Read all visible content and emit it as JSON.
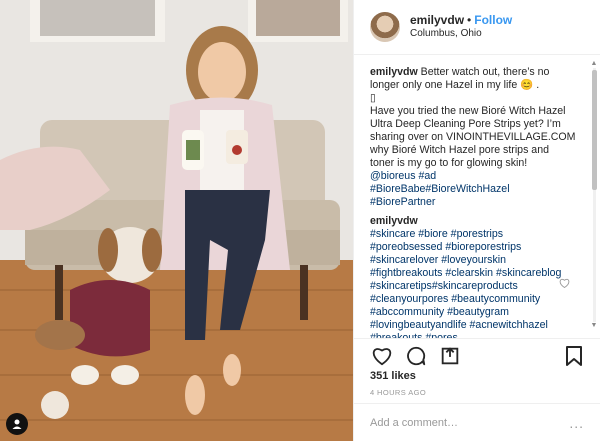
{
  "header": {
    "username": "emilyvdw",
    "separator": "•",
    "follow_label": "Follow",
    "location": "Columbus, Ohio"
  },
  "caption": {
    "username": "emilyvdw",
    "text1": "Better watch out, there’s no longer only one Hazel in my life 😊 .",
    "placeholder_char": "▯",
    "text2": "Have you tried the new Bioré Witch Hazel Ultra Deep Cleaning Pore Strips yet? I’m sharing over on VINOINTHEVILLAGE.COM why Bioré Witch Hazel pore strips and toner is my go to for glowing skin!",
    "tags": "@bioreus #ad #BioreBabe#BioreWitchHazel #BiorePartner"
  },
  "comment": {
    "username": "emilyvdw",
    "tags": "#skincare #biore #porestrips #poreobsessed #bioreporestrips #skincarelover #loveyourskin #fightbreakouts #clearskin #skincareblog #skincaretips#skincareproducts #cleanyourpores #beautycommunity #abccommunity #beautygram #lovingbeautyandlife #acnewitchhazel #breakouts #pores"
  },
  "icons": {
    "like": "heart-icon",
    "comment": "comment-icon",
    "share": "share-icon",
    "save": "bookmark-icon",
    "comment_like": "heart-outline-icon",
    "more": "more-options-icon"
  },
  "likes": "351 likes",
  "timestamp": "4 HOURS AGO",
  "add_comment": {
    "placeholder": "Add a comment…",
    "more": "..."
  },
  "colors": {
    "link": "#003569",
    "follow": "#3897f0"
  }
}
